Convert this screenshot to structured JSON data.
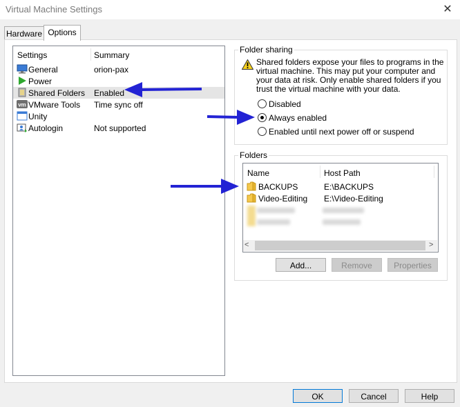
{
  "window": {
    "title": "Virtual Machine Settings",
    "close_glyph": "✕"
  },
  "tabs": [
    {
      "label": "Hardware"
    },
    {
      "label": "Options"
    }
  ],
  "settings": {
    "headers": {
      "settings": "Settings",
      "summary": "Summary"
    },
    "rows": [
      {
        "name": "General",
        "summary": "orion-pax",
        "icon": "monitor-icon"
      },
      {
        "name": "Power",
        "summary": "",
        "icon": "play-icon"
      },
      {
        "name": "Shared Folders",
        "summary": "Enabled",
        "icon": "shared-folder-icon"
      },
      {
        "name": "VMware Tools",
        "summary": "Time sync off",
        "icon": "vm-icon"
      },
      {
        "name": "Unity",
        "summary": "",
        "icon": "unity-window-icon"
      },
      {
        "name": "Autologin",
        "summary": "Not supported",
        "icon": "autologin-icon"
      }
    ]
  },
  "folder_sharing": {
    "legend": "Folder sharing",
    "warning_lines": [
      "Shared folders expose your files to programs in the",
      "virtual machine. This may put your computer and",
      "your data at risk. Only enable shared folders if you",
      "trust the virtual machine with your data."
    ],
    "options": [
      "Disabled",
      "Always enabled",
      "Enabled until next power off or suspend"
    ],
    "selected": "Always enabled"
  },
  "folders": {
    "legend": "Folders",
    "headers": {
      "name": "Name",
      "host_path": "Host Path"
    },
    "rows": [
      {
        "name": "BACKUPS",
        "host_path": "E:\\BACKUPS"
      },
      {
        "name": "Video-Editing",
        "host_path": "E:\\Video-Editing"
      }
    ],
    "scroll_left": "<",
    "scroll_right": ">",
    "buttons": {
      "add": "Add...",
      "remove": "Remove",
      "properties": "Properties"
    }
  },
  "footer": {
    "ok": "OK",
    "cancel": "Cancel",
    "help": "Help"
  },
  "colors": {
    "annotation_arrow": "#2323d4",
    "selected_row": "#e5e5e5",
    "folder_yellow": "#f5c84c"
  }
}
